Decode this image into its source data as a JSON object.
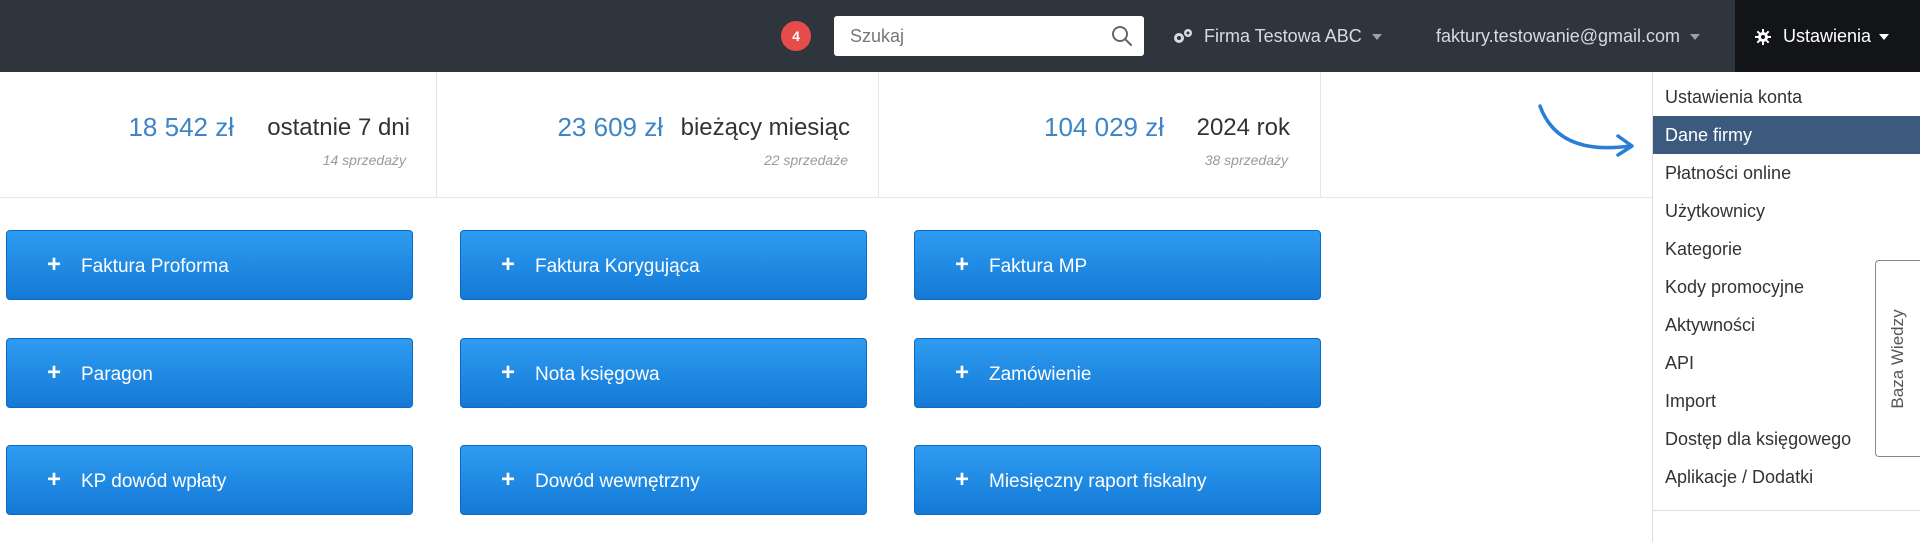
{
  "navbar": {
    "notification_count": "4",
    "search_placeholder": "Szukaj",
    "company": "Firma Testowa ABC",
    "email": "faktury.testowanie@gmail.com",
    "settings_label": "Ustawienia"
  },
  "stats": [
    {
      "amount": "18 542 zł",
      "period": "ostatnie 7 dni",
      "count": "14 sprzedaży"
    },
    {
      "amount": "23 609 zł",
      "period": "bieżący miesiąc",
      "count": "22 sprzedaże"
    },
    {
      "amount": "104 029 zł",
      "period": "2024 rok",
      "count": "38 sprzedaży"
    }
  ],
  "actions": {
    "faktura_proforma": "Faktura Proforma",
    "faktura_korygujaca": "Faktura Korygująca",
    "faktura_mp": "Faktura MP",
    "paragon": "Paragon",
    "nota_ksiegowa": "Nota księgowa",
    "zamowienie": "Zamówienie",
    "kp_dowod_wplaty": "KP dowód wpłaty",
    "dowod_wewnetrzny": "Dowód wewnętrzny",
    "miesieczny_raport": "Miesięczny raport fiskalny"
  },
  "settings_menu": {
    "items": [
      "Ustawienia konta",
      "Dane firmy",
      "Płatności online",
      "Użytkownicy",
      "Kategorie",
      "Kody promocyjne",
      "Aktywności",
      "API",
      "Import",
      "Dostęp dla księgowego",
      "Aplikacje / Dodatki"
    ],
    "active_index": 1
  },
  "side_tab": "Baza Wiedzy",
  "colors": {
    "navbar": "#2f353d",
    "accent_blue": "#3d85c6",
    "button_blue": "#1a86e0",
    "menu_active": "#3c5a7e",
    "badge_red": "#e74c4c"
  },
  "icons": {
    "search": "search-icon",
    "company": "gears-icon",
    "settings": "gear-icon",
    "plus": "plus-icon",
    "arrow": "curved-arrow-icon"
  }
}
